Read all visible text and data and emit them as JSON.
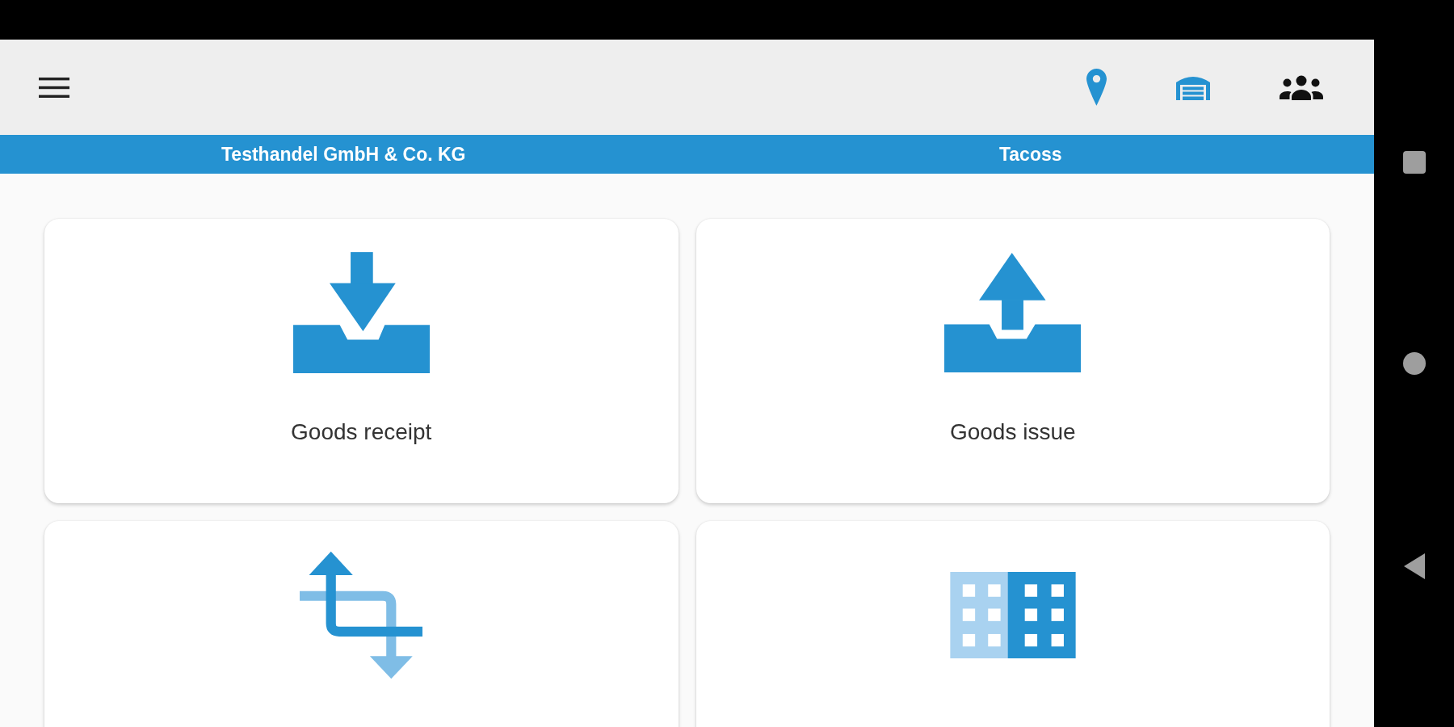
{
  "info_bar": {
    "items": [
      "Testhandel GmbH & Co. KG",
      "Tacoss"
    ]
  },
  "tiles": [
    {
      "kind": "receipt",
      "label": "Goods receipt"
    },
    {
      "kind": "issue",
      "label": "Goods issue"
    },
    {
      "kind": "transfer"
    },
    {
      "kind": "stock"
    }
  ]
}
